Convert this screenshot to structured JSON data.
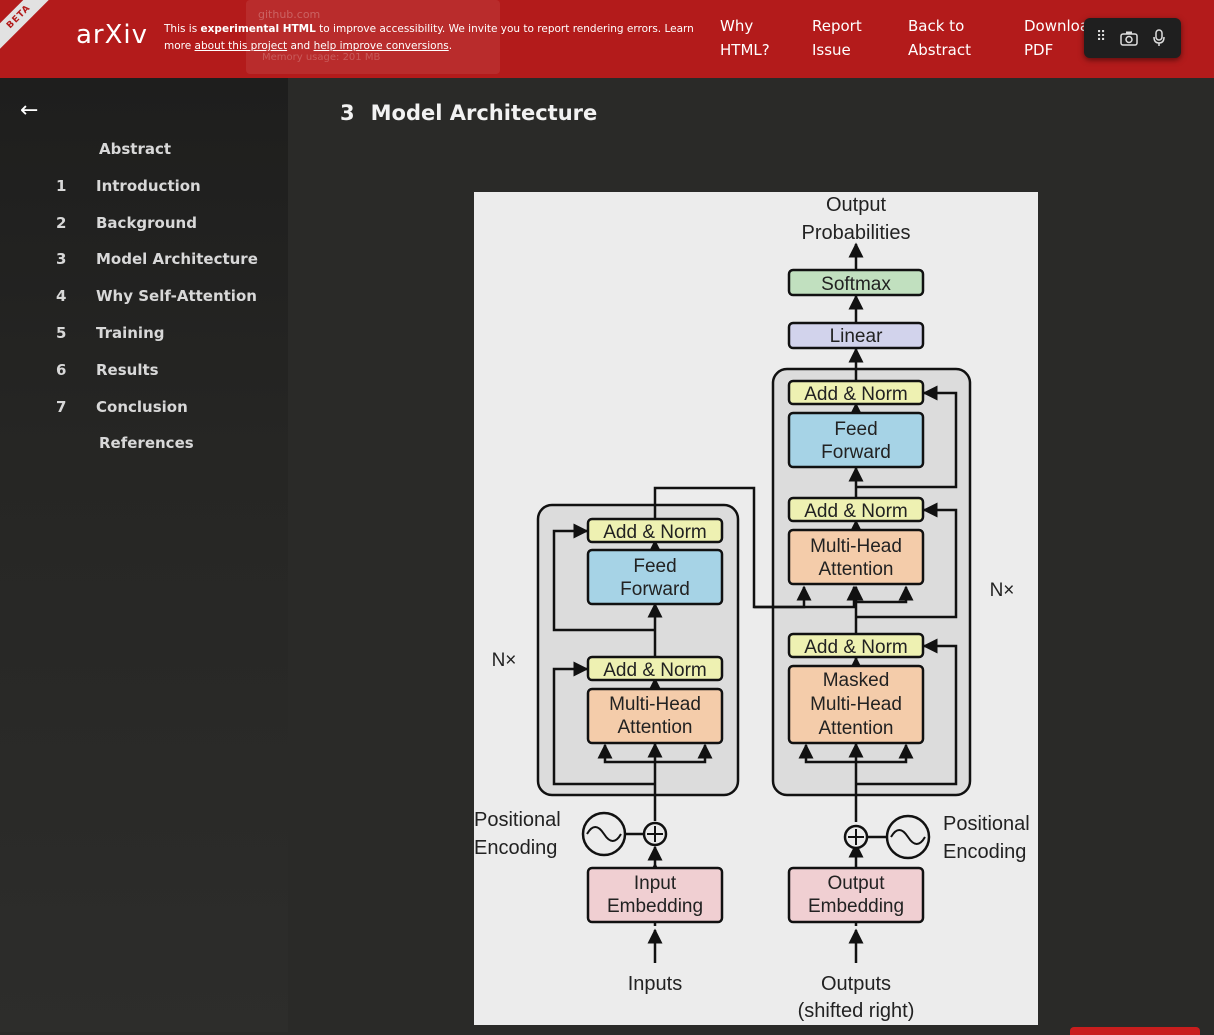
{
  "header": {
    "beta": "BETA",
    "logo": "arXiv",
    "notice_prefix": "This is ",
    "notice_bold": "experimental HTML",
    "notice_mid": " to improve accessibility. We invite you to report rendering errors. Learn more ",
    "notice_link1": "about this project",
    "notice_and": " and ",
    "notice_link2": "help improve conversions",
    "notice_end": ".",
    "ghost_url": "github.com",
    "ghost_mem": "Memory usage: 201 MB",
    "nav": [
      {
        "line1": "Why",
        "line2": "HTML?"
      },
      {
        "line1": "Report",
        "line2": "Issue"
      },
      {
        "line1": "Back to",
        "line2": "Abstract"
      },
      {
        "line1": "Downloa",
        "line2": "PDF"
      }
    ],
    "toolbar_icons": [
      "drag-handle-icon",
      "camera-icon",
      "microphone-icon"
    ]
  },
  "sidebar": {
    "back_icon": "arrow-left-icon",
    "toc": [
      {
        "num": "",
        "label": "Abstract"
      },
      {
        "num": "1",
        "label": "Introduction"
      },
      {
        "num": "2",
        "label": "Background"
      },
      {
        "num": "3",
        "label": "Model Architecture"
      },
      {
        "num": "4",
        "label": "Why Self-Attention"
      },
      {
        "num": "5",
        "label": "Training"
      },
      {
        "num": "6",
        "label": "Results"
      },
      {
        "num": "7",
        "label": "Conclusion"
      },
      {
        "num": "",
        "label": "References"
      }
    ]
  },
  "main": {
    "section_num": "3",
    "section_title": "Model Architecture"
  },
  "figure": {
    "output_probabilities_1": "Output",
    "output_probabilities_2": "Probabilities",
    "softmax": "Softmax",
    "linear": "Linear",
    "add_norm": "Add & Norm",
    "feed_forward_1": "Feed",
    "feed_forward_2": "Forward",
    "multi_head_1": "Multi-Head",
    "multi_head_2": "Attention",
    "masked_1": "Masked",
    "masked_2": "Multi-Head",
    "masked_3": "Attention",
    "nx": "N×",
    "pos_enc_1": "Positional",
    "pos_enc_2": "Encoding",
    "input_emb_1": "Input",
    "input_emb_2": "Embedding",
    "output_emb_1": "Output",
    "output_emb_2": "Embedding",
    "inputs": "Inputs",
    "outputs_1": "Outputs",
    "outputs_2": "(shifted right)",
    "colors": {
      "add_norm": "#eef1b2",
      "feed_forward": "#a6d3e6",
      "attention": "#f4ccaa",
      "embedding": "#f0cfd2",
      "softmax": "#c1e0bf",
      "linear": "#d2d3ec",
      "block_bg": "#dcdcdc"
    }
  }
}
